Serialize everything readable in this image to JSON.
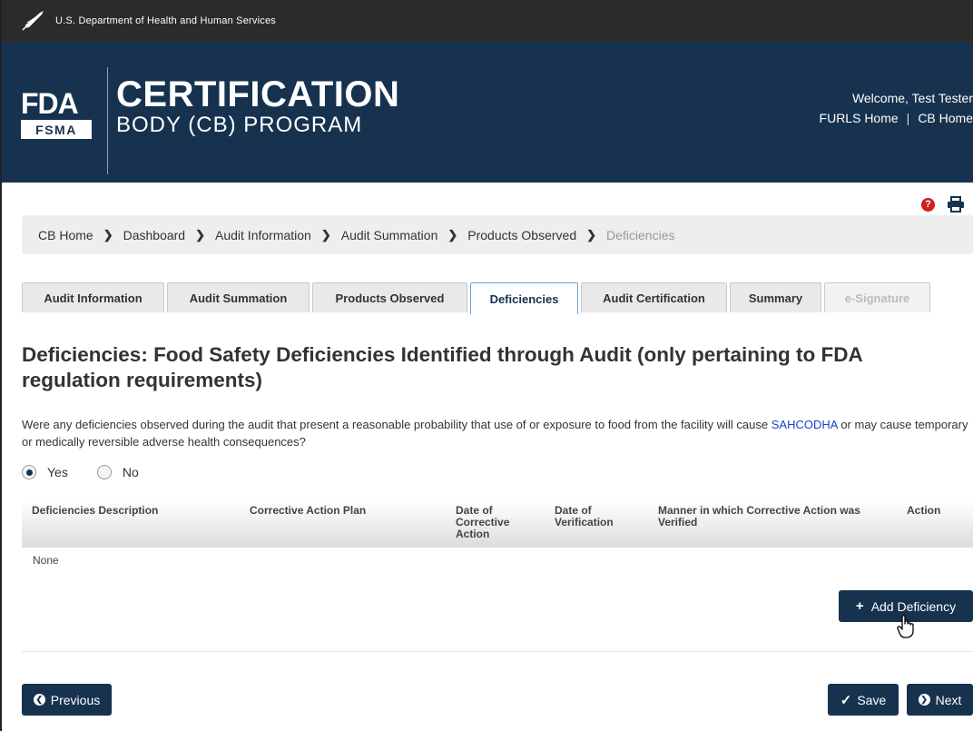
{
  "hhs_bar": {
    "text": "U.S. Department of Health and Human Services"
  },
  "banner": {
    "logo_fda": "FDA",
    "logo_fsma": "FSMA",
    "title_main": "CERTIFICATION",
    "title_sub": "BODY (CB) PROGRAM",
    "welcome": "Welcome, Test Tester",
    "links": [
      "FURLS Home",
      "CB Home"
    ],
    "link_separator": "|"
  },
  "utility": {
    "help_glyph": "?"
  },
  "breadcrumb": [
    "CB Home",
    "Dashboard",
    "Audit Information",
    "Audit Summation",
    "Products Observed",
    "Deficiencies"
  ],
  "tabs": [
    "Audit Information",
    "Audit Summation",
    "Products Observed",
    "Deficiencies",
    "Audit Certification",
    "Summary",
    "e-Signature"
  ],
  "page": {
    "heading": "Deficiencies: Food Safety Deficiencies Identified through Audit (only pertaining to FDA regulation requirements)",
    "question_before": "Were any deficiencies observed during the audit that present a reasonable probability that use of or exposure to food from the facility will cause ",
    "question_link": "SAHCODHA",
    "question_after": " or may cause temporary or medically reversible adverse health consequences?",
    "radio_yes": "Yes",
    "radio_no": "No"
  },
  "table": {
    "headers": [
      "Deficiencies Description",
      "Corrective Action Plan",
      "Date of Corrective Action",
      "Date of Verification",
      "Manner in which Corrective Action was Verified",
      "Action"
    ],
    "empty_text": "None"
  },
  "buttons": {
    "add_deficiency": "Add Deficiency",
    "previous": "Previous",
    "save": "Save",
    "next": "Next"
  },
  "colors": {
    "navy": "#16324f",
    "hhs_bar": "#2b2b2b",
    "help_red": "#cc1f1f",
    "link_blue": "#1a3fcf"
  }
}
